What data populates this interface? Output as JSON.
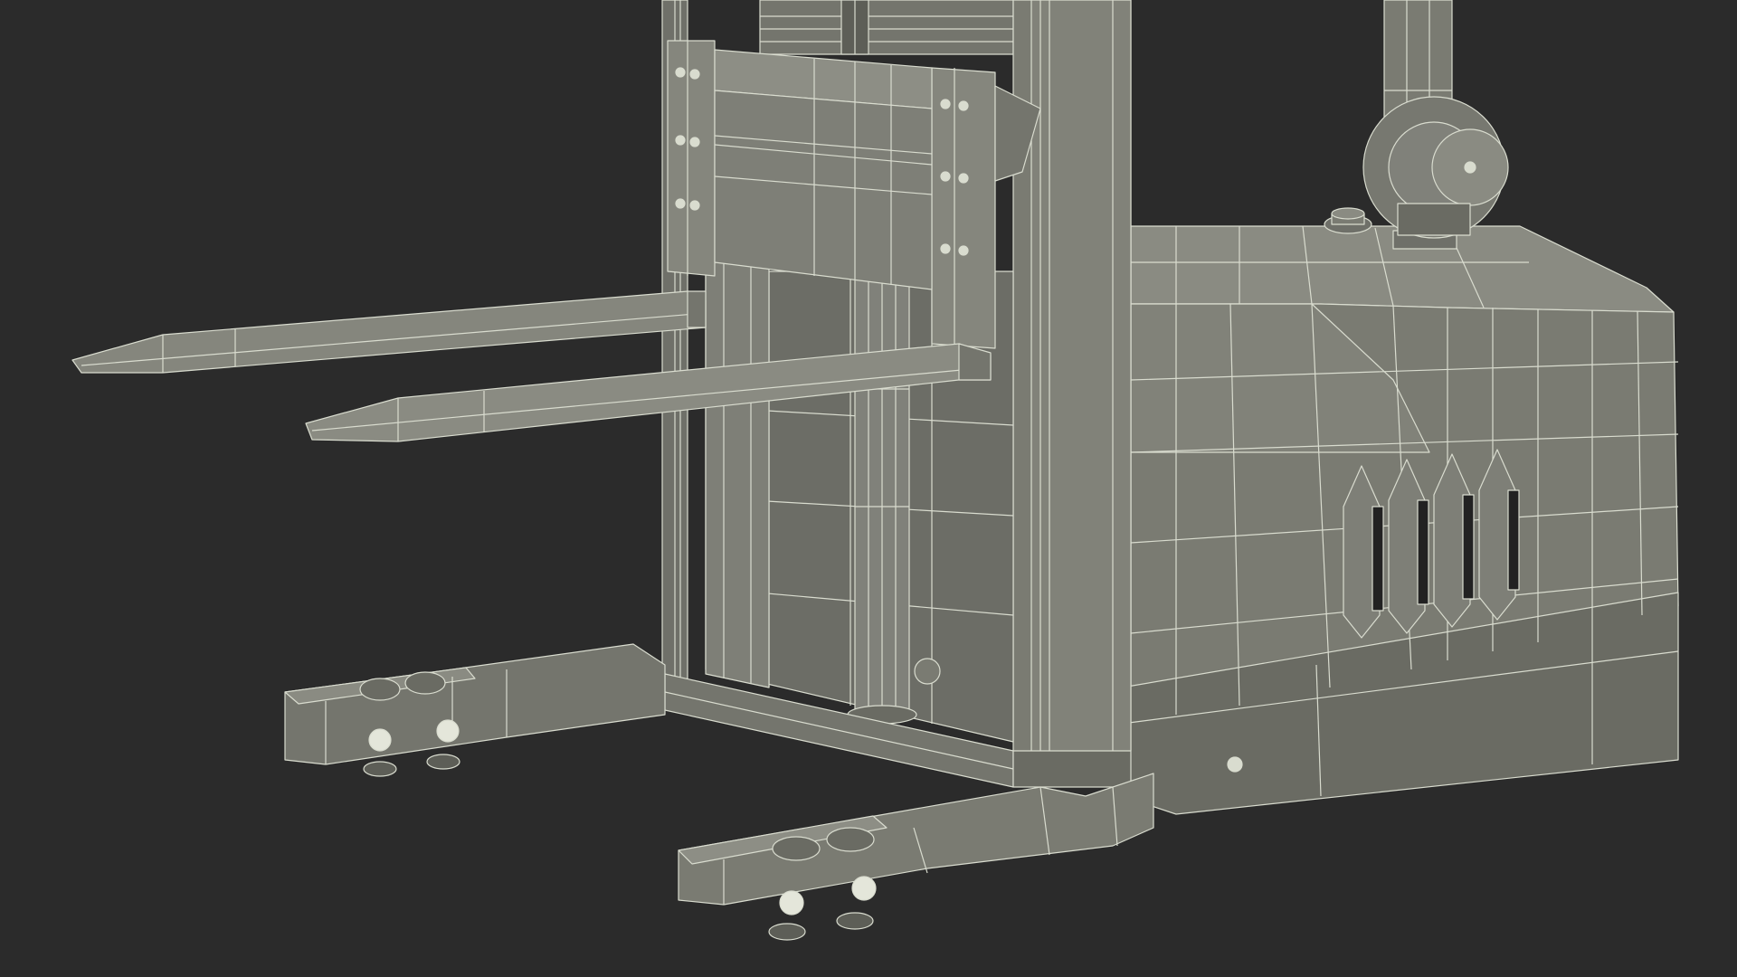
{
  "scene": {
    "subject": "wireframe-render-forklift-stacker",
    "colors": {
      "background": "#2b2b2b",
      "surface": "#7a7b72",
      "surface_light": "#8a8b82",
      "surface_dark": "#5d5e57",
      "wire": "#d9dccf",
      "shadow": "#1e1e1e"
    }
  }
}
